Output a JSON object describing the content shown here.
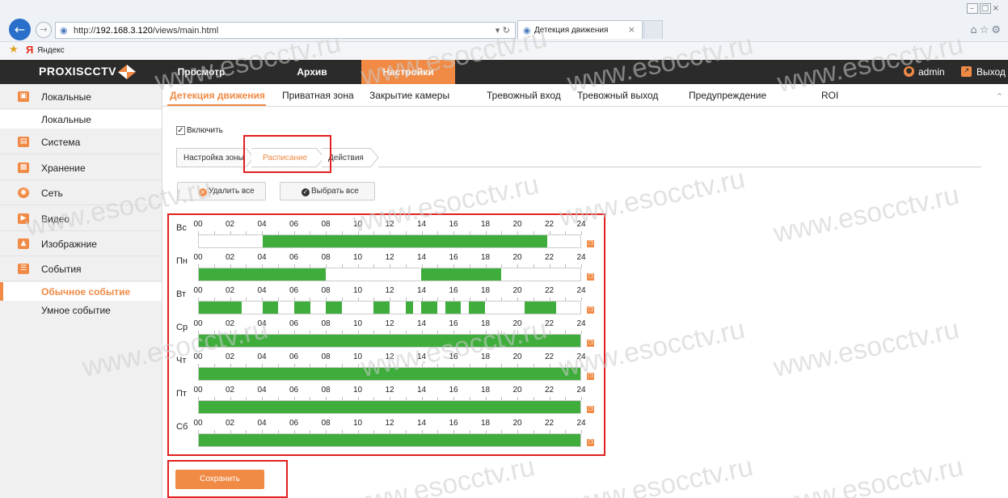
{
  "browser": {
    "back_icon": "arrow-left-icon",
    "forward_icon": "arrow-right-icon",
    "url_prefix": "http://",
    "url_host": "192.168.3.120",
    "url_path": "/views/main.html",
    "tab_title": "Детекция движения",
    "favorites_label": "Яндекс"
  },
  "nav": {
    "brand": "PROXISCCTV",
    "items": [
      "Просмотр",
      "Архив",
      "Настройки"
    ],
    "active_item": "Настройки",
    "user": "admin",
    "logout": "Выход",
    "accent_color": "#f08a45"
  },
  "sidebar": {
    "items": [
      {
        "label": "Локальные",
        "icon": "monitor-icon",
        "color": "#f08a45"
      },
      {
        "label": "Система",
        "icon": "system-icon",
        "color": "#f08a45"
      },
      {
        "label": "Хранение",
        "icon": "storage-icon",
        "color": "#f08a45"
      },
      {
        "label": "Сеть",
        "icon": "network-icon",
        "color": "#f08a45"
      },
      {
        "label": "Видео",
        "icon": "video-icon",
        "color": "#f08a45"
      },
      {
        "label": "Изображние",
        "icon": "image-icon",
        "color": "#f08a45"
      },
      {
        "label": "События",
        "icon": "events-icon",
        "color": "#f08a45"
      }
    ],
    "sub_local": "Локальные",
    "sub_events": [
      "Обычное событие",
      "Умное событие"
    ],
    "active_sub": "Обычное событие"
  },
  "content": {
    "tabs": [
      "Детекция движения",
      "Приватная зона",
      "Закрытие камеры",
      "Тревожный вход",
      "Тревожный выход",
      "Предупреждение",
      "ROI"
    ],
    "active_tab": "Детекция движения",
    "enable_label": "Включить",
    "enable_checked": true,
    "steps": [
      "Настройка зоны",
      "Расписание",
      "Действия"
    ],
    "active_step": "Расписание",
    "delete_all": "Удалить все",
    "select_all": "Выбрать все",
    "save": "Сохранить"
  },
  "schedule": {
    "hour_labels": [
      "00",
      "02",
      "04",
      "06",
      "08",
      "10",
      "12",
      "14",
      "16",
      "18",
      "20",
      "22",
      "24"
    ],
    "bar_color": "#3fad3c",
    "days": [
      {
        "label": "Вс",
        "segments": [
          [
            4,
            21.9
          ]
        ]
      },
      {
        "label": "Пн",
        "segments": [
          [
            0,
            8
          ],
          [
            14,
            19
          ]
        ]
      },
      {
        "label": "Вт",
        "segments": [
          [
            0,
            2.7
          ],
          [
            4,
            5
          ],
          [
            6,
            7
          ],
          [
            8,
            9
          ],
          [
            11,
            12
          ],
          [
            13,
            13.5
          ],
          [
            14,
            15
          ],
          [
            15.5,
            16.5
          ],
          [
            17,
            18
          ],
          [
            20.5,
            22.5
          ]
        ]
      },
      {
        "label": "Ср",
        "segments": [
          [
            0,
            24
          ]
        ]
      },
      {
        "label": "Чт",
        "segments": [
          [
            0,
            24
          ]
        ]
      },
      {
        "label": "Пт",
        "segments": [
          [
            0,
            24
          ]
        ]
      },
      {
        "label": "Сб",
        "segments": [
          [
            0,
            24
          ]
        ]
      }
    ]
  },
  "watermark": "www.esocctv.ru"
}
